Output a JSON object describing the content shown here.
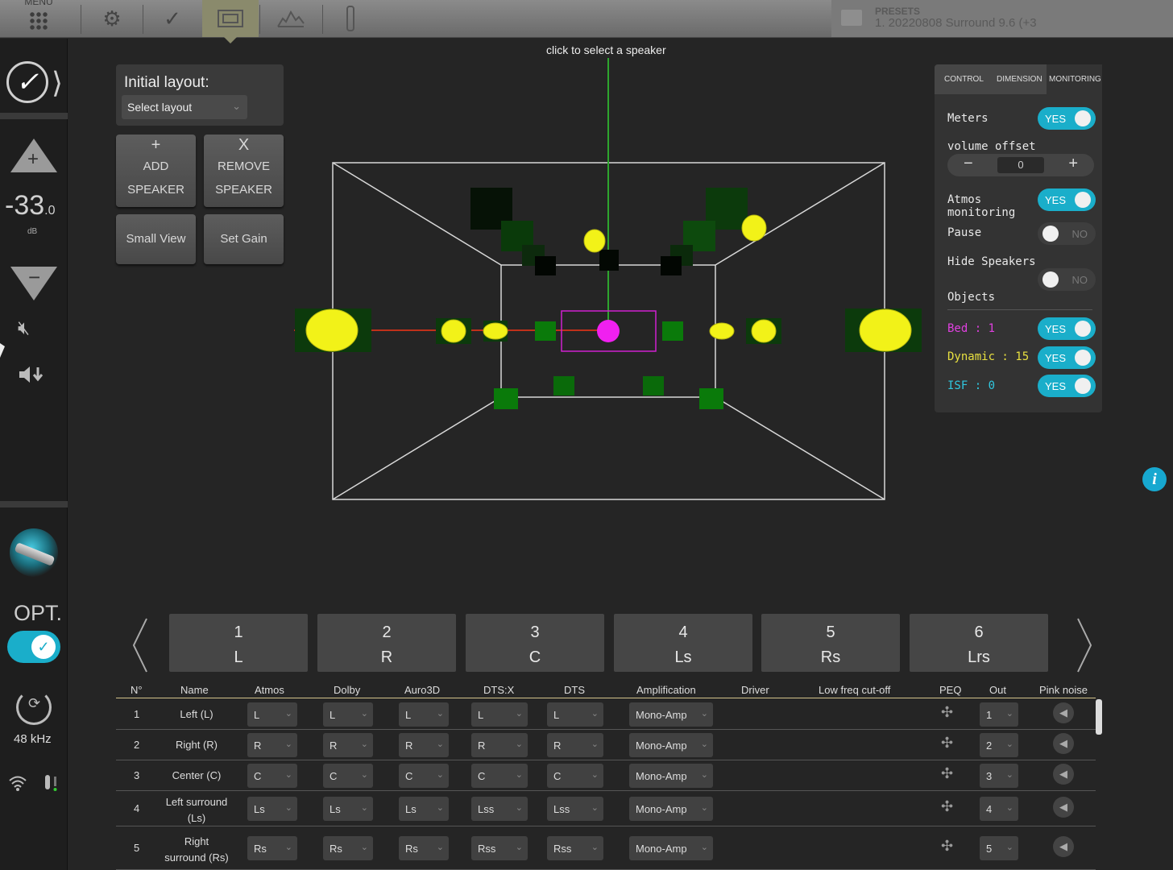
{
  "topbar": {
    "menu_label": "MENU",
    "icons": [
      "apps-icon",
      "settings-icon",
      "check-icon",
      "layout-icon",
      "graph-icon",
      "microphone-icon"
    ],
    "presets_label": "PRESETS",
    "preset_value": "1. 20220808 Surround 9.6 (+3"
  },
  "left_panel": {
    "volume": "-33",
    "volume_decimal": ".0",
    "volume_unit": "dB",
    "opt_label": "OPT.",
    "sample_rate": "48 kHz"
  },
  "layout_box": {
    "title": "Initial layout:",
    "select_placeholder": "Select layout"
  },
  "buttons": {
    "add_symbol": "+",
    "add_line1": "ADD",
    "add_line2": "SPEAKER",
    "remove_symbol": "X",
    "remove_line1": "REMOVE",
    "remove_line2": "SPEAKER",
    "small_view": "Small View",
    "set_gain": "Set Gain"
  },
  "view": {
    "hint": "click to select a speaker"
  },
  "right_panel": {
    "tabs": [
      "CONTROL",
      "DIMENSION",
      "MONITORING"
    ],
    "active_tab": "MONITORING",
    "meters_label": "Meters",
    "meters_value": "YES",
    "volume_offset_label": "volume offset",
    "volume_offset_value": "0",
    "atmos_label_1": "Atmos",
    "atmos_label_2": "monitoring",
    "atmos_value": "YES",
    "pause_label": "Pause",
    "pause_value": "NO",
    "hide_label": "Hide Speakers",
    "hide_value": "NO",
    "objects_label": "Objects",
    "bed_label": "Bed : 1",
    "bed_value": "YES",
    "dynamic_label": "Dynamic : 15",
    "dynamic_value": "YES",
    "isf_label": "ISF : 0",
    "isf_value": "YES",
    "colors": {
      "accent": "#1aaeca",
      "bed": "#e040e0",
      "dynamic": "#e8e040",
      "isf": "#30c8e0"
    }
  },
  "speaker_tabs": [
    {
      "num": "1",
      "code": "L"
    },
    {
      "num": "2",
      "code": "R"
    },
    {
      "num": "3",
      "code": "C"
    },
    {
      "num": "4",
      "code": "Ls"
    },
    {
      "num": "5",
      "code": "Rs"
    },
    {
      "num": "6",
      "code": "Lrs"
    }
  ],
  "table": {
    "headers": [
      "N°",
      "Name",
      "Atmos",
      "Dolby",
      "Auro3D",
      "DTS:X",
      "DTS",
      "Amplification",
      "Driver",
      "Low freq cut-off",
      "PEQ",
      "Out",
      "Pink noise"
    ],
    "rows": [
      {
        "n": "1",
        "name1": "Left (L)",
        "name2": "",
        "atmos": "L",
        "dolby": "L",
        "auro": "L",
        "dtsx": "L",
        "dts": "L",
        "amp": "Mono-Amp",
        "out": "1"
      },
      {
        "n": "2",
        "name1": "Right (R)",
        "name2": "",
        "atmos": "R",
        "dolby": "R",
        "auro": "R",
        "dtsx": "R",
        "dts": "R",
        "amp": "Mono-Amp",
        "out": "2"
      },
      {
        "n": "3",
        "name1": "Center (C)",
        "name2": "",
        "atmos": "C",
        "dolby": "C",
        "auro": "C",
        "dtsx": "C",
        "dts": "C",
        "amp": "Mono-Amp",
        "out": "3"
      },
      {
        "n": "4",
        "name1": "Left surround",
        "name2": "(Ls)",
        "atmos": "Ls",
        "dolby": "Ls",
        "auro": "Ls",
        "dtsx": "Lss",
        "dts": "Lss",
        "amp": "Mono-Amp",
        "out": "4"
      },
      {
        "n": "5",
        "name1": "Right",
        "name2": "surround (Rs)",
        "atmos": "Rs",
        "dolby": "Rs",
        "auro": "Rs",
        "dtsx": "Rss",
        "dts": "Rss",
        "amp": "Mono-Amp",
        "out": "5"
      }
    ]
  }
}
